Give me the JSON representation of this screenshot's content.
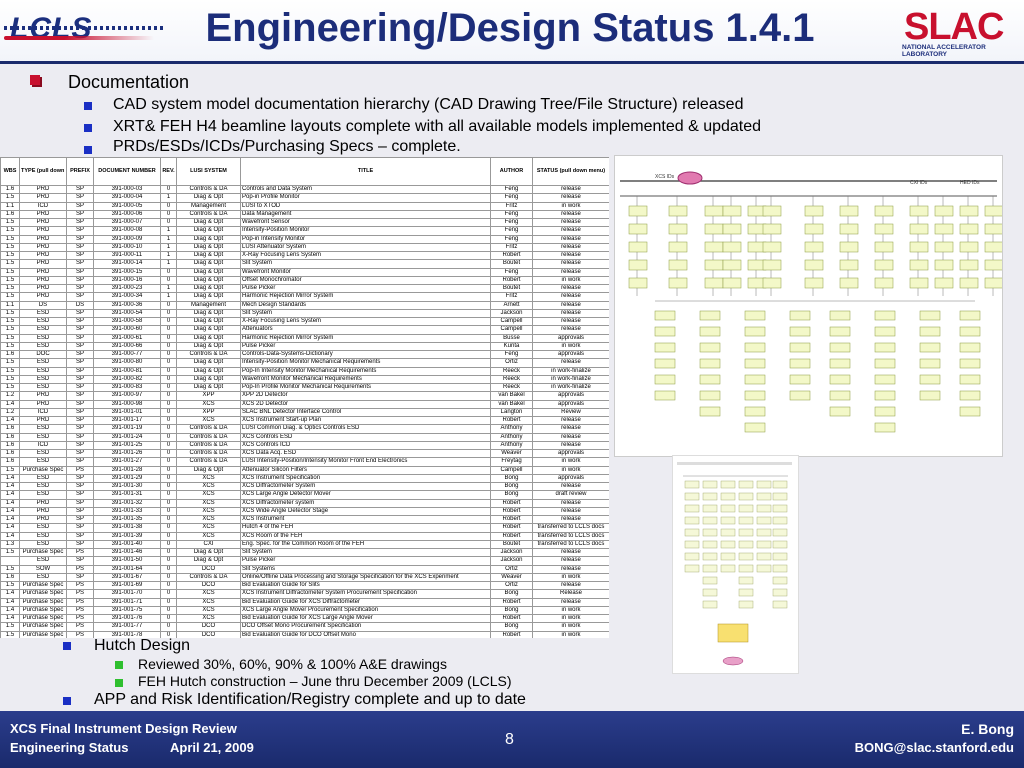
{
  "header": {
    "lcls_logo": "LCLS",
    "title": "Engineering/Design Status 1.4.1",
    "slac_logo": "SLAC",
    "slac_subtitle": "NATIONAL ACCELERATOR LABORATORY"
  },
  "bullets": {
    "documentation": "Documentation",
    "sub1": "CAD system model documentation hierarchy (CAD Drawing Tree/File Structure) released",
    "sub2": "XRT& FEH H4 beamline layouts complete with all available models implemented & updated",
    "sub3": "PRDs/ESDs/ICDs/Purchasing Specs – complete.",
    "hutch": "Hutch Design",
    "hutch1": "Reviewed 30%, 60%, 90% & 100% A&E drawings",
    "hutch2": "FEH Hutch construction – June thru December 2009 (LCLS)",
    "app": "APP and Risk Identification/Registry complete and up to date"
  },
  "table": {
    "headers": [
      "WBS",
      "TYPE (pull down menu)",
      "PREFIX",
      "DOCUMENT NUMBER",
      "REV.",
      "LUSI SYSTEM",
      "TITLE",
      "AUTHOR",
      "STATUS (pull down menu)"
    ],
    "rows": [
      [
        "1.6",
        "PRD",
        "SP",
        "391-000-03",
        "0",
        "Controls & DA",
        "Controls and Data System",
        "Feng",
        "release"
      ],
      [
        "1.5",
        "PRD",
        "SP",
        "391-000-04",
        "1",
        "Diag & Opt",
        "Pop-in Profile Monitor",
        "Feng",
        "release"
      ],
      [
        "1.1",
        "ICD",
        "SP",
        "391-000-05",
        "0",
        "Management",
        "LUSI to XTOD",
        "Fritz",
        "in work"
      ],
      [
        "1.6",
        "PRD",
        "SP",
        "391-000-06",
        "0",
        "Controls & DA",
        "Data Management",
        "Feng",
        "release"
      ],
      [
        "1.5",
        "PRD",
        "SP",
        "391-000-07",
        "0",
        "Diag & Opt",
        "Wavefront Sensor",
        "Feng",
        "release"
      ],
      [
        "1.5",
        "PRD",
        "SP",
        "391-000-08",
        "1",
        "Diag & Opt",
        "Intensity-Position Monitor",
        "Feng",
        "release"
      ],
      [
        "1.5",
        "PRD",
        "SP",
        "391-000-09",
        "1",
        "Diag & Opt",
        "Pop-in Intensity Monitor",
        "Feng",
        "release"
      ],
      [
        "1.5",
        "PRD",
        "SP",
        "391-000-10",
        "1",
        "Diag & Opt",
        "LUSI Attenuator System",
        "Fritz",
        "release"
      ],
      [
        "1.5",
        "PRD",
        "SP",
        "391-000-11",
        "1",
        "Diag & Opt",
        "X-Ray Focusing Lens System",
        "Robert",
        "release"
      ],
      [
        "1.5",
        "PRD",
        "SP",
        "391-000-14",
        "1",
        "Diag & Opt",
        "Slit System",
        "Boutet",
        "release"
      ],
      [
        "1.5",
        "PRD",
        "SP",
        "391-000-15",
        "0",
        "Diag & Opt",
        "Wavefront Monitor",
        "Feng",
        "release"
      ],
      [
        "1.5",
        "PRD",
        "SP",
        "391-000-16",
        "0",
        "Diag & Opt",
        "Offset Monochromator",
        "Robert",
        "in work"
      ],
      [
        "1.5",
        "PRD",
        "SP",
        "391-000-23",
        "1",
        "Diag & Opt",
        "Pulse Picker",
        "Boutet",
        "release"
      ],
      [
        "1.5",
        "PRD",
        "SP",
        "391-000-34",
        "1",
        "Diag & Opt",
        "Harmonic Rejection Mirror System",
        "Fritz",
        "release"
      ],
      [
        "1.1",
        "DS",
        "DS",
        "391-000-36",
        "0",
        "Management",
        "Mech Design Standards",
        "Arnett",
        "release"
      ],
      [
        "1.5",
        "ESD",
        "SP",
        "391-000-54",
        "0",
        "Diag & Opt",
        "Slit System",
        "Jackson",
        "release"
      ],
      [
        "1.5",
        "ESD",
        "SP",
        "391-000-58",
        "0",
        "Diag & Opt",
        "X-Ray Focusing Lens System",
        "Campell",
        "release"
      ],
      [
        "1.5",
        "ESD",
        "SP",
        "391-000-60",
        "0",
        "Diag & Opt",
        "Attenuators",
        "Campell",
        "release"
      ],
      [
        "1.5",
        "ESD",
        "SP",
        "391-000-61",
        "0",
        "Diag & Opt",
        "Harmonic Rejection Mirror System",
        "Busse",
        "approvals"
      ],
      [
        "1.5",
        "ESD",
        "SP",
        "391-000-66",
        "0",
        "Diag & Opt",
        "Pulse Picker",
        "Kurita",
        "in work"
      ],
      [
        "1.6",
        "DOC",
        "SP",
        "391-000-77",
        "0",
        "Controls & DA",
        "Controls-Data-Systems-Dictionary",
        "Feng",
        "approvals"
      ],
      [
        "1.5",
        "ESD",
        "SP",
        "391-000-80",
        "0",
        "Diag & Opt",
        "Intensity-Position Monitor Mechanical Requirements",
        "Ortiz",
        "release"
      ],
      [
        "1.5",
        "ESD",
        "SP",
        "391-000-81",
        "0",
        "Diag & Opt",
        "Pop-In Intensity Monitor Mechanical Requirements",
        "Reeck",
        "in work-finalize"
      ],
      [
        "1.5",
        "ESD",
        "SP",
        "391-000-82",
        "0",
        "Diag & Opt",
        "Wavefront Monitor Mechanical Requirements",
        "Reeck",
        "in work-finalize"
      ],
      [
        "1.5",
        "ESD",
        "SP",
        "391-000-83",
        "0",
        "Diag & Opt",
        "Pop-In Profile Monitor Mechanical Requirements",
        "Reeck",
        "in work-finalize"
      ],
      [
        "1.2",
        "PRD",
        "SP",
        "391-000-97",
        "0",
        "XPP",
        "XPP 2D Detector",
        "van Bakel",
        "approvals"
      ],
      [
        "1.4",
        "PRD",
        "SP",
        "391-000-98",
        "0",
        "XCS",
        "XCS 2D Detector",
        "van Bakel",
        "approvals"
      ],
      [
        "1.2",
        "ICD",
        "SP",
        "391-001-01",
        "0",
        "XPP",
        "SLAC BNL Detector Interface Control",
        "Langton",
        "Review"
      ],
      [
        "1.4",
        "PRD",
        "SP",
        "391-001-17",
        "0",
        "XCS",
        "XCS Instrument Start-up Plan",
        "Robert",
        "release"
      ],
      [
        "1.6",
        "ESD",
        "SP",
        "391-001-19",
        "0",
        "Controls & DA",
        "LUSI Common Diag. & Optics Controls ESD",
        "Anthony",
        "release"
      ],
      [
        "1.6",
        "ESD",
        "SP",
        "391-001-24",
        "0",
        "Controls & DA",
        "XCS Controls ESD",
        "Anthony",
        "release"
      ],
      [
        "1.6",
        "ICD",
        "SP",
        "391-001-25",
        "0",
        "Controls & DA",
        "XCS Controls ICD",
        "Anthony",
        "release"
      ],
      [
        "1.6",
        "ESD",
        "SP",
        "391-001-26",
        "0",
        "Controls & DA",
        "XCS Data Acq. ESD",
        "Weaver",
        "approvals"
      ],
      [
        "1.6",
        "ESD",
        "SP",
        "391-001-27",
        "0",
        "Controls & DA",
        "LUSI Intensity-Position/Intensity Monitor Front End Electronics",
        "Freytag",
        "in work"
      ],
      [
        "1.5",
        "Purchase Spec",
        "PS",
        "391-001-28",
        "0",
        "Diag & Opt",
        "Attenuator Silicon Filters",
        "Campell",
        "in work"
      ],
      [
        "1.4",
        "ESD",
        "SP",
        "391-001-29",
        "0",
        "XCS",
        "XCS Instrument Specification",
        "Bong",
        "approvals"
      ],
      [
        "1.4",
        "ESD",
        "SP",
        "391-001-30",
        "0",
        "XCS",
        "XCS Diffractometer System",
        "Bong",
        "release"
      ],
      [
        "1.4",
        "ESD",
        "SP",
        "391-001-31",
        "0",
        "XCS",
        "XCS Large Angle Detector Mover",
        "Bong",
        "draft review"
      ],
      [
        "1.4",
        "PRD",
        "SP",
        "391-001-32",
        "0",
        "XCS",
        "XCS Diffractometer system",
        "Robert",
        "release"
      ],
      [
        "1.4",
        "PRD",
        "SP",
        "391-001-33",
        "0",
        "XCS",
        "XCS Wide Angle Detector Stage",
        "Robert",
        "release"
      ],
      [
        "1.4",
        "PRD",
        "SP",
        "391-001-35",
        "0",
        "XCS",
        "XCS Instrument",
        "Robert",
        "release"
      ],
      [
        "1.4",
        "ESD",
        "SP",
        "391-001-38",
        "0",
        "XCS",
        "Hutch 4 of the FEH",
        "Robert",
        "transferred to LCLS docs"
      ],
      [
        "1.4",
        "ESD",
        "SP",
        "391-001-39",
        "0",
        "XCS",
        "XCS Room of the FEH",
        "Robert",
        "transferred to LCLS docs"
      ],
      [
        "1.3",
        "ESD",
        "SP",
        "391-001-40",
        "0",
        "CXI",
        "Eng. Spec. for the Common Room of the FEH",
        "Boutet",
        "transferred to LCLS docs"
      ],
      [
        "1.5",
        "Purchase Spec",
        "PS",
        "391-001-46",
        "0",
        "Diag & Opt",
        "Slit System",
        "Jackson",
        "release"
      ],
      [
        "",
        "ESD",
        "SP",
        "391-001-50",
        "0",
        "Diag & Opt",
        "Pulse Picker",
        "Jackson",
        "release"
      ],
      [
        "1.5",
        "SOW",
        "PS",
        "391-001-64",
        "0",
        "DCO",
        "Slit Systems",
        "Ortiz",
        "release"
      ],
      [
        "1.6",
        "ESD",
        "SP",
        "391-001-67",
        "0",
        "Controls & DA",
        "Online/Offline Data Processing and Storage Specification for the XCS Experiment",
        "Weaver",
        "in work"
      ],
      [
        "1.5",
        "Purchase Spec",
        "PS",
        "391-001-69",
        "0",
        "DCO",
        "Bid Evaluation Guide for Slits",
        "Ortiz",
        "release"
      ],
      [
        "1.4",
        "Purchase Spec",
        "PS",
        "391-001-70",
        "0",
        "XCS",
        "XCS Instrument Diffractometer System Procurement Specification",
        "Bong",
        "Release"
      ],
      [
        "1.4",
        "Purchase Spec",
        "PS",
        "391-001-71",
        "0",
        "XCS",
        "Bid Evaluation Guide for XCS Diffractometer",
        "Robert",
        "release"
      ],
      [
        "1.4",
        "Purchase Spec",
        "PS",
        "391-001-75",
        "0",
        "XCS",
        "XCS Large Angle Mover Procurement Specification",
        "Bong",
        "in work"
      ],
      [
        "1.4",
        "Purchase Spec",
        "PS",
        "391-001-76",
        "0",
        "XCS",
        "Bid Evaluation Guide for XCS Large Angle Mover",
        "Robert",
        "in work"
      ],
      [
        "1.5",
        "Purchase Spec",
        "PS",
        "391-001-77",
        "0",
        "DCO",
        "DCO Offset Mono Procurement Specification",
        "Bong",
        "in work"
      ],
      [
        "1.5",
        "Purchase Spec",
        "PS",
        "391-001-78",
        "0",
        "DCO",
        "Bid Evaluation Guide for DCO Offset Mono",
        "Robert",
        "in work"
      ]
    ]
  },
  "diagram1": {
    "label_left": "XCS IDs",
    "label_mid": "CXI IDs",
    "label_right": "HED IDs"
  },
  "footer": {
    "line1": "XCS Final Instrument Design Review",
    "line2": "Engineering Status",
    "date": "April 21, 2009",
    "page": "8",
    "author": "E. Bong",
    "email": "BONG@slac.stanford.edu"
  },
  "colors": {
    "title": "#1c2d7a",
    "accent_red": "#c8102e",
    "bullet_blue": "#1a2fc4",
    "bullet_green": "#2fbf2f",
    "footer_bg": "#1a2a6c"
  }
}
